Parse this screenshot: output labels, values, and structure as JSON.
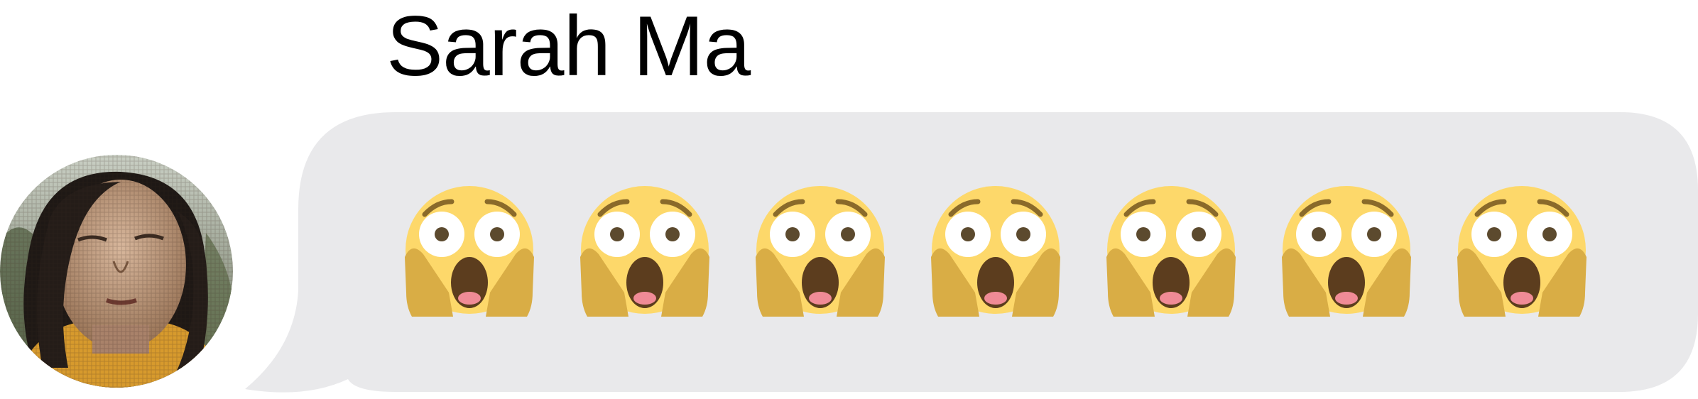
{
  "message": {
    "sender_name": "Sarah Ma",
    "avatar_icon": "contact-photo-avatar",
    "bubble_color": "#e9e9eb",
    "emoji_icon": "face-screaming-in-fear-icon",
    "emoji_glyph": "😱",
    "emoji_count": 7,
    "emoji_colors": {
      "face": "#fdd86a",
      "hands": "#d9ad45",
      "mouth": "#5c3d1e",
      "tongue": "#f08b96",
      "eye_white": "#ffffff",
      "pupil": "#5c4a2e",
      "brow": "#8a6a2a"
    }
  }
}
